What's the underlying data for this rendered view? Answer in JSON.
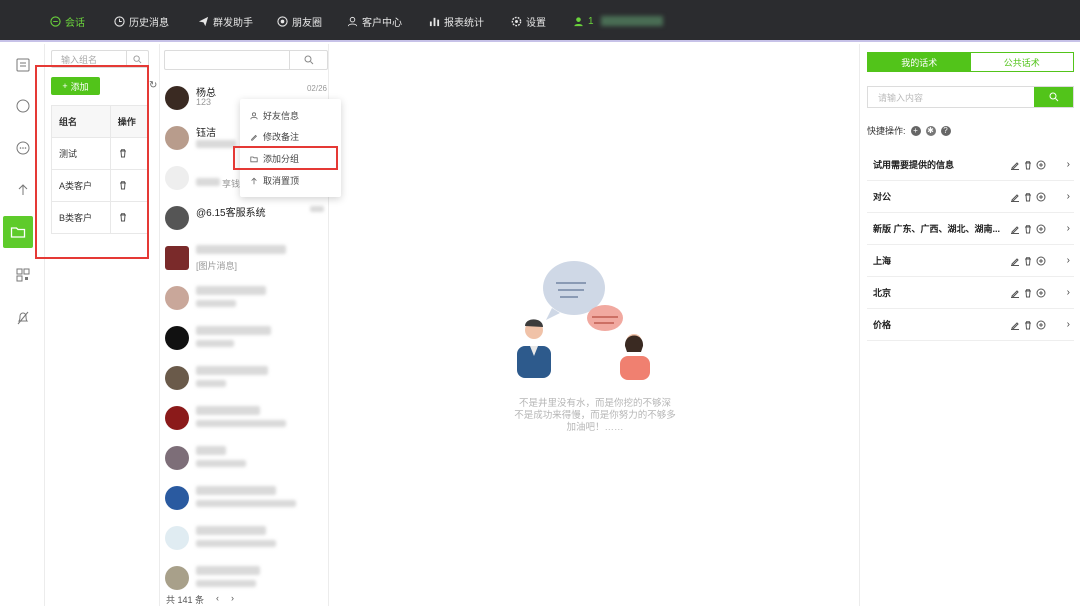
{
  "nav": {
    "items": [
      {
        "label": "会话",
        "icon": "chat-bubble-icon",
        "active": true
      },
      {
        "label": "历史消息",
        "icon": "clock-icon",
        "active": false
      },
      {
        "label": "群发助手",
        "icon": "send-icon",
        "active": false
      },
      {
        "label": "朋友圈",
        "icon": "moments-icon",
        "active": false
      },
      {
        "label": "客户中心",
        "icon": "person-icon",
        "active": false
      },
      {
        "label": "报表统计",
        "icon": "bar-chart-icon",
        "active": false
      },
      {
        "label": "设置",
        "icon": "gear-icon",
        "active": false
      }
    ],
    "user_initial": "1"
  },
  "rail": {
    "active": "folder-icon"
  },
  "groups": {
    "search_placeholder": "输入组名",
    "add_label": "添加",
    "col_name": "组名",
    "col_action": "操作",
    "rows": [
      {
        "name": "测试"
      },
      {
        "name": "A类客户"
      },
      {
        "name": "B类客户"
      }
    ]
  },
  "chats": {
    "items": [
      {
        "name": "杨总",
        "sub": "123",
        "date": "02/26"
      },
      {
        "name": "钰洁",
        "sub": "",
        "date": ""
      },
      {
        "name": "",
        "sub": "享钱",
        "date": ""
      },
      {
        "name": "@6.15客服系统",
        "sub": "",
        "date": ""
      },
      {
        "name": "",
        "sub": "[图片消息]",
        "date": ""
      }
    ],
    "footer_total": "共 141 条",
    "prev": "‹",
    "next": "›"
  },
  "context_menu": {
    "items": [
      {
        "label": "好友信息",
        "icon": "person-icon"
      },
      {
        "label": "修改备注",
        "icon": "pencil-icon"
      },
      {
        "label": "添加分组",
        "icon": "folder-icon"
      },
      {
        "label": "取消置顶",
        "icon": "arrow-up-icon"
      }
    ]
  },
  "main": {
    "quote_lines": [
      "不是井里没有水，而是你挖的不够深",
      "不是成功来得慢，而是你努力的不够多",
      "加油吧！……"
    ]
  },
  "scripts": {
    "tab_mine": "我的话术",
    "tab_public": "公共话术",
    "search_placeholder": "请输入内容",
    "quick_label": "快捷操作:",
    "items": [
      {
        "label": "试用需要提供的信息"
      },
      {
        "label": "对公"
      },
      {
        "label": "新版 广东、广西、湖北、湖南..."
      },
      {
        "label": "上海"
      },
      {
        "label": "北京"
      },
      {
        "label": "价格"
      }
    ]
  },
  "colors": {
    "accent": "#52c41a",
    "topbar": "#2b2c2f",
    "highlight_box": "#e53935"
  }
}
